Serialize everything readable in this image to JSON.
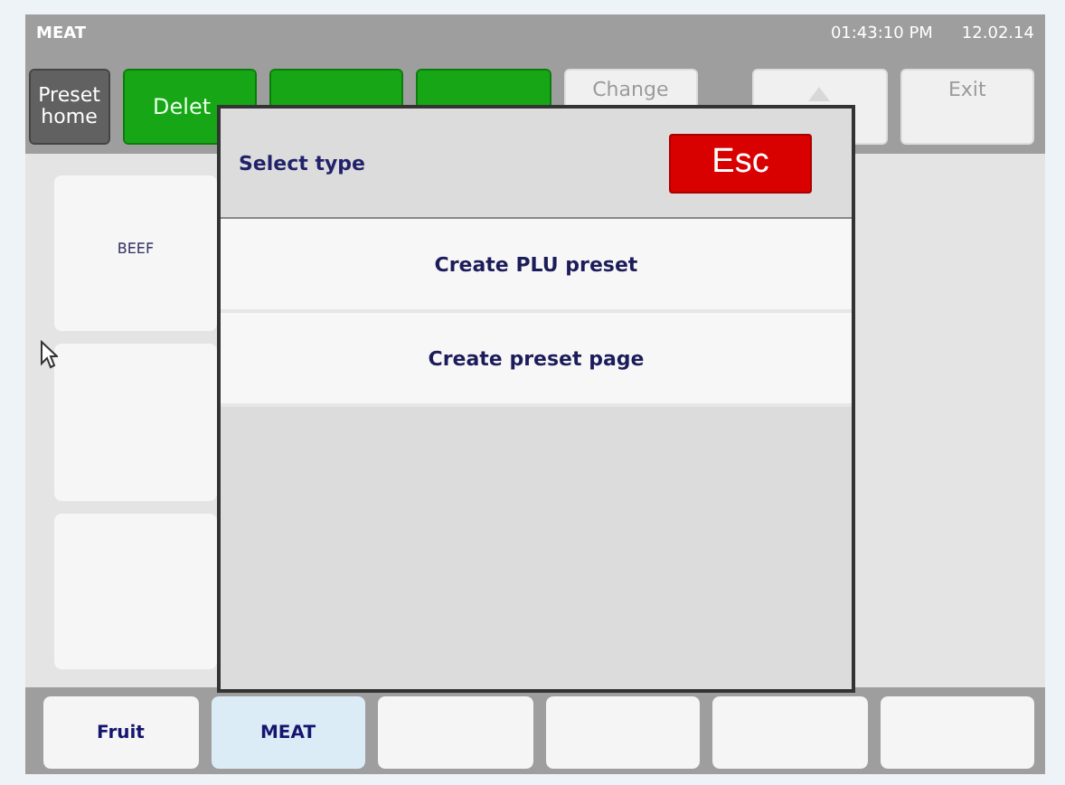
{
  "header": {
    "title": "MEAT",
    "time": "01:43:10 PM",
    "date": "12.02.14"
  },
  "toolbar": [
    {
      "kind": "home",
      "label": "Preset home",
      "disabled": false
    },
    {
      "kind": "action",
      "label": "Delet",
      "disabled": false
    },
    {
      "kind": "action",
      "disabled": false
    },
    {
      "kind": "action",
      "disabled": false
    },
    {
      "kind": "action",
      "label": "Change",
      "disabled": true
    },
    {
      "kind": "up-arrow",
      "disabled": true
    },
    {
      "kind": "action",
      "label": "Exit",
      "disabled": true
    }
  ],
  "tiles": [
    {
      "kind": "preset",
      "label": "BEEF"
    },
    {
      "kind": "blank"
    },
    {
      "kind": "blank"
    }
  ],
  "dialog": {
    "title": "Select type",
    "close": "Esc",
    "options": [
      "Create PLU preset",
      "Create preset page"
    ]
  },
  "tabs": [
    {
      "label": "Fruit",
      "selected": false
    },
    {
      "label": "MEAT",
      "selected": true
    },
    {
      "selected": false
    },
    {
      "selected": false
    },
    {
      "selected": false
    },
    {
      "selected": false
    }
  ]
}
